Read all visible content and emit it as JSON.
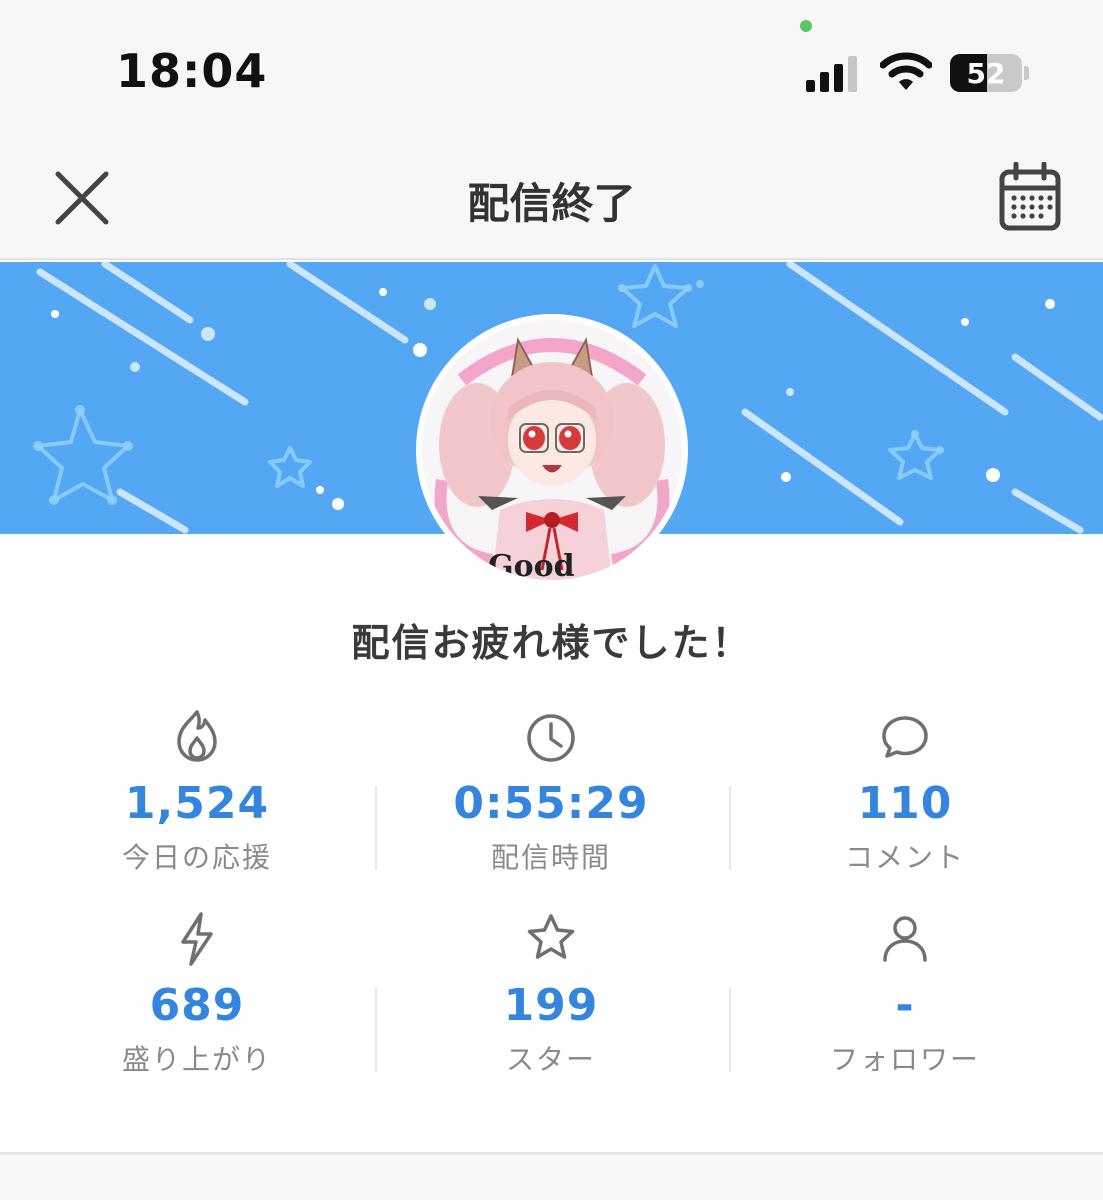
{
  "status_bar": {
    "time": "18:04",
    "battery_percent": 52,
    "battery_label": "52"
  },
  "nav": {
    "title": "配信終了",
    "close_icon": "close-icon",
    "calendar_icon": "calendar-icon"
  },
  "message": "配信お疲れ様でした！",
  "stats": [
    {
      "icon": "flame-icon",
      "value": "1,524",
      "label": "今日の応援"
    },
    {
      "icon": "clock-icon",
      "value": "0:55:29",
      "label": "配信時間"
    },
    {
      "icon": "comment-icon",
      "value": "110",
      "label": "コメント"
    },
    {
      "icon": "lightning-icon",
      "value": "689",
      "label": "盛り上がり"
    },
    {
      "icon": "star-icon",
      "value": "199",
      "label": "スター"
    },
    {
      "icon": "person-icon",
      "value": "-",
      "label": "フォロワー"
    }
  ],
  "colors": {
    "accent": "#3485de",
    "banner": "#53a7f3"
  }
}
